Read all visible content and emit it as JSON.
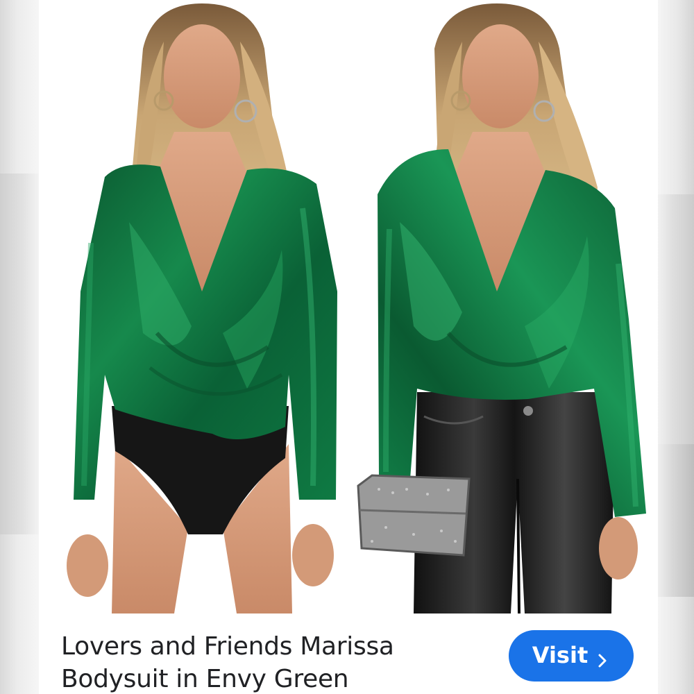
{
  "product": {
    "title_line_1": "Lovers and Friends Marissa",
    "title_line_2": "Bodysuit in Envy Green",
    "image_alt": "Model wearing green metallic wrap bodysuit, front views"
  },
  "actions": {
    "visit_label": "Visit",
    "visit_icon": "chevron-right-icon"
  },
  "colors": {
    "accent": "#1a73e8",
    "product_green": "#0e6b3a",
    "title_text": "#202124"
  }
}
